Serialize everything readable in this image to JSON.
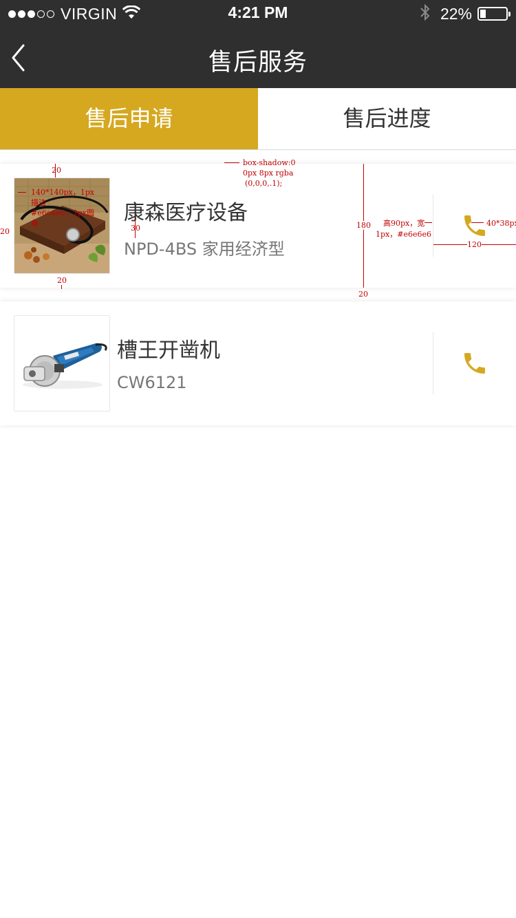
{
  "status_bar": {
    "carrier": "VIRGIN",
    "time": "4:21 PM",
    "battery_percent": "22%",
    "battery_level": 0.22,
    "signal_bars_filled": 3,
    "signal_bars_total": 5
  },
  "nav": {
    "title": "售后服务",
    "back_icon": "chevron-left-icon"
  },
  "tabs": [
    {
      "label": "售后申请",
      "active": true
    },
    {
      "label": "售后进度",
      "active": false
    }
  ],
  "items": [
    {
      "title": "康森医疗设备",
      "model": "NPD-4BS 家用经济型",
      "action_icon": "phone-icon"
    },
    {
      "title": "槽王开凿机",
      "model": "CW6121",
      "action_icon": "phone-icon"
    }
  ],
  "annotations": {
    "margin_top": "20",
    "margin_bottom": "20",
    "margin_left": "20",
    "thumb_spec_1": "140*140px，1px",
    "thumb_spec_2": "描边",
    "thumb_spec_3": "#e6e6e6，2px圆",
    "thumb_spec_4": "角",
    "text_gap": "30",
    "shadow_1": "box-shadow:0",
    "shadow_2": "0px 8px rgba",
    "shadow_3": "(0,0,0,.1);",
    "row_height": "180",
    "row_gap": "20",
    "divider_1": "高90px，宽",
    "divider_2": "1px，#e6e6e6",
    "icon_size": "40*38px",
    "icon_area": "120"
  },
  "colors": {
    "accent": "#d5a820",
    "bar": "#2f2f2f",
    "annotation": "#c00000"
  }
}
